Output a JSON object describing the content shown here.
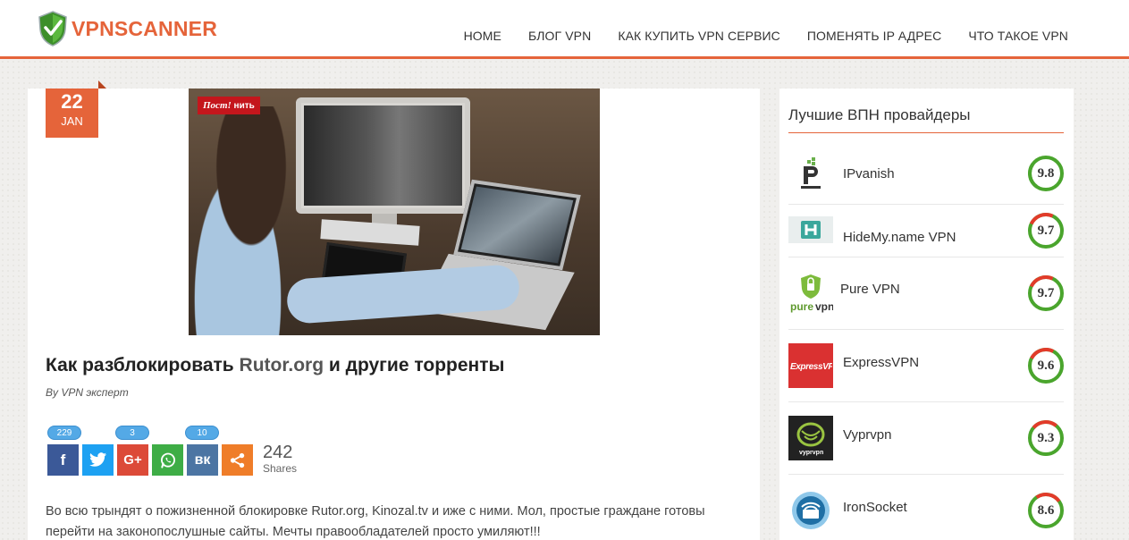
{
  "header": {
    "logo_text": "VPNSCANNER",
    "nav": [
      {
        "label": "HOME"
      },
      {
        "label": "БЛОГ VPN"
      },
      {
        "label": "КАК КУПИТЬ VPN СЕРВИС"
      },
      {
        "label": "ПОМЕНЯТЬ IP АДРЕС"
      },
      {
        "label": "ЧТО ТАКОЕ VPN"
      }
    ]
  },
  "post": {
    "date_day": "22",
    "date_month": "JAN",
    "hero_tag_main": "Пост!",
    "hero_tag_suffix": "нить",
    "title_before": "Как разблокировать ",
    "title_highlight": "Rutor.org",
    "title_after": " и другие торренты",
    "author": "By VPN эксперт",
    "share": {
      "buttons": [
        {
          "network": "facebook",
          "glyph": "f",
          "count": "229",
          "color": "#3b5998"
        },
        {
          "network": "twitter",
          "glyph": "t",
          "count": "",
          "color": "#1da1f2"
        },
        {
          "network": "google-plus",
          "glyph": "G+",
          "count": "3",
          "color": "#dc4a38"
        },
        {
          "network": "whatsapp",
          "glyph": "W",
          "count": "",
          "color": "#3ead46"
        },
        {
          "network": "vk",
          "glyph": "вк",
          "count": "10",
          "color": "#4c75a3"
        },
        {
          "network": "share",
          "glyph": "<",
          "count": "",
          "color": "#ef7d29"
        }
      ],
      "total": "242",
      "total_label": "Shares"
    },
    "body": "Во всю трындят о пожизненной блокировке Rutor.org, Kinozal.tv и иже с ними. Мол, простые граждане готовы перейти на законопослушные сайты. Мечты правообладателей просто умиляют!!!"
  },
  "sidebar": {
    "title": "Лучшие ВПН провайдеры",
    "providers": [
      {
        "name": "IPvanish",
        "score": "9.8",
        "score_value": 9.8,
        "logo_icon": "ipvanish-logo"
      },
      {
        "name": "HideMy.name VPN",
        "score": "9.7",
        "score_value": 9.7,
        "logo_icon": "hidemyname-logo"
      },
      {
        "name": "Pure VPN",
        "score": "9.7",
        "score_value": 9.7,
        "logo_icon": "purevpn-logo"
      },
      {
        "name": "ExpressVPN",
        "score": "9.6",
        "score_value": 9.6,
        "logo_icon": "expressvpn-logo"
      },
      {
        "name": "Vyprvpn",
        "score": "9.3",
        "score_value": 9.3,
        "logo_icon": "vyprvpn-logo"
      },
      {
        "name": "IronSocket",
        "score": "8.6",
        "score_value": 8.6,
        "logo_icon": "ironsocket-logo"
      }
    ]
  }
}
